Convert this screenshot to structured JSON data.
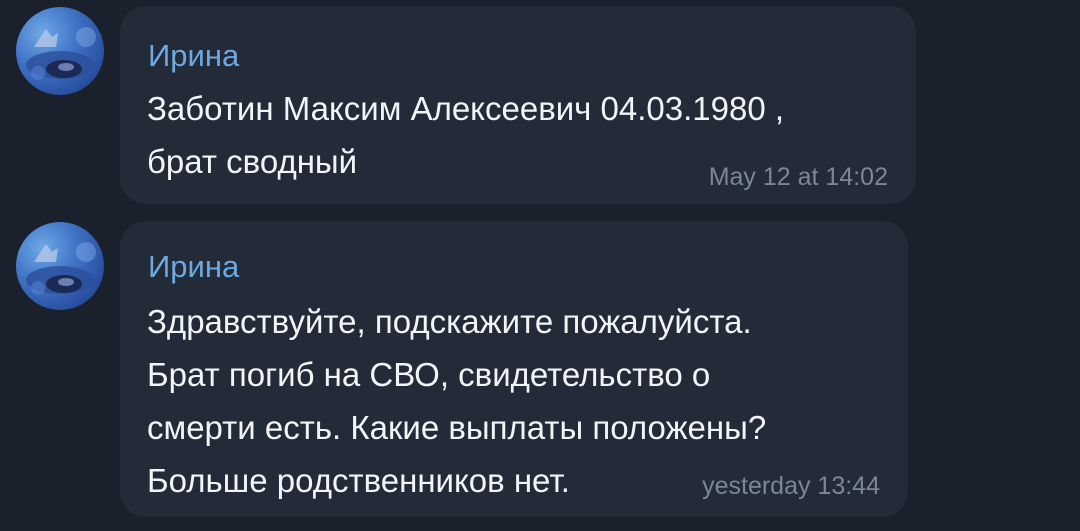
{
  "messages": [
    {
      "sender": "Ирина",
      "text": "Заботин Максим Алексеевич 04.03.1980 ,\nбрат сводный",
      "time": "May 12 at 14:02"
    },
    {
      "sender": "Ирина",
      "text": "Здравствуйте, подскажите пожалуйста.\nБрат погиб на СВО, свидетельство о\nсмерти есть. Какие выплаты положены?\nБольше родственников нет.",
      "time": "yesterday 13:44"
    }
  ],
  "colors": {
    "background": "#1a212c",
    "bubble": "#222b37",
    "sender_name": "#6ea8e0",
    "message_text": "#f2f4f7",
    "timestamp": "#7b8796"
  },
  "avatar_icon": "avatar-photo-underwater"
}
